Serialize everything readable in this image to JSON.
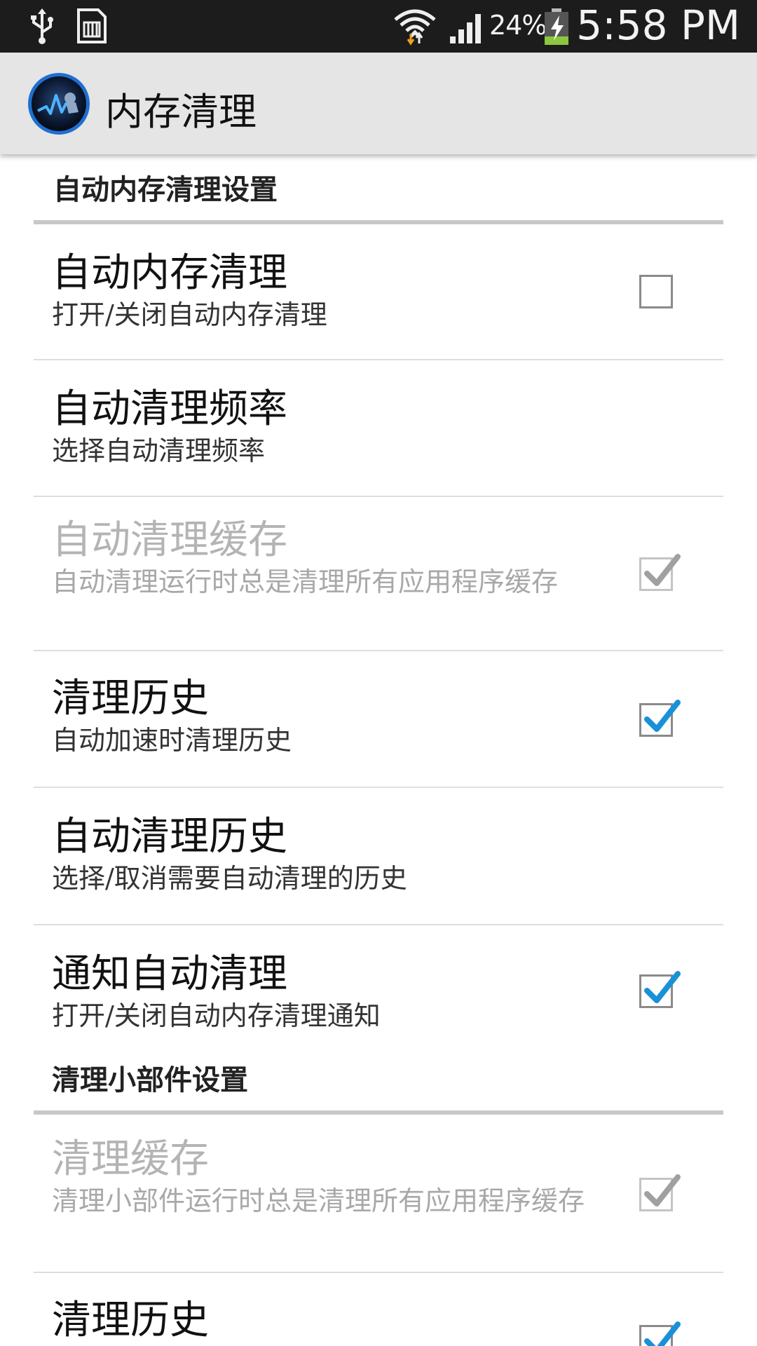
{
  "status_bar": {
    "battery_percent": "24%",
    "time": "5:58 PM",
    "icons": [
      "usb-icon",
      "sd-card-icon",
      "wifi-icon",
      "signal-icon",
      "battery-charging-icon"
    ]
  },
  "action_bar": {
    "title": "内存清理",
    "icon": "app-logo-icon"
  },
  "sections": [
    {
      "header": "自动内存清理设置",
      "items": [
        {
          "title": "自动内存清理",
          "summary": "打开/关闭自动内存清理",
          "checkbox": "unchecked",
          "enabled": true
        },
        {
          "title": "自动清理频率",
          "summary": "选择自动清理频率",
          "checkbox": "none",
          "enabled": true
        },
        {
          "title": "自动清理缓存",
          "summary": "自动清理运行时总是清理所有应用程序缓存",
          "checkbox": "checked",
          "enabled": false
        },
        {
          "title": "清理历史",
          "summary": "自动加速时清理历史",
          "checkbox": "checked",
          "enabled": true
        },
        {
          "title": "自动清理历史",
          "summary": "选择/取消需要自动清理的历史",
          "checkbox": "none",
          "enabled": true
        },
        {
          "title": "通知自动清理",
          "summary": "打开/关闭自动内存清理通知",
          "checkbox": "checked",
          "enabled": true
        }
      ]
    },
    {
      "header": "清理小部件设置",
      "items": [
        {
          "title": "清理缓存",
          "summary": "清理小部件运行时总是清理所有应用程序缓存",
          "checkbox": "checked",
          "enabled": false
        },
        {
          "title": "清理历史",
          "summary": "",
          "checkbox": "checked",
          "enabled": true
        }
      ]
    }
  ],
  "colors": {
    "status_bar_bg": "#1c1c1c",
    "action_bar_bg": "#e5e5e5",
    "check_blue": "#1a90d8",
    "check_disabled": "#a0a0a0",
    "divider": "#dedede",
    "section_divider": "#c8c8c8"
  }
}
